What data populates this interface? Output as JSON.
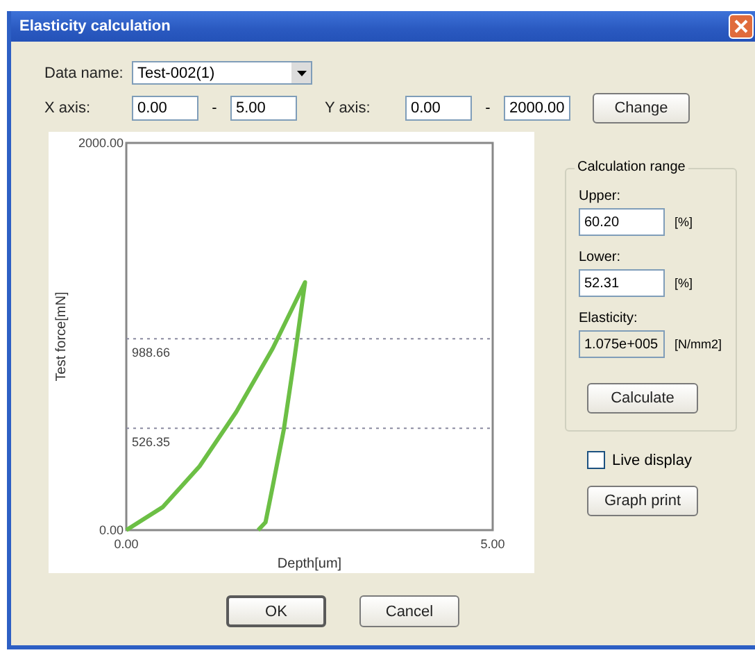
{
  "window": {
    "title": "Elasticity calculation"
  },
  "data_name": {
    "label": "Data name:",
    "value": "Test-002(1)"
  },
  "x_axis": {
    "label": "X axis:",
    "min": "0.00",
    "max": "5.00"
  },
  "y_axis": {
    "label": "Y axis:",
    "min": "0.00",
    "max": "2000.00"
  },
  "range_separator": "-",
  "change_button": "Change",
  "graph": {
    "chart_data": {
      "type": "line",
      "xlabel": "Depth[um]",
      "ylabel": "Test force[mN]",
      "xlim": [
        0,
        5
      ],
      "ylim": [
        0,
        2000
      ],
      "xticks": [
        {
          "value": 0,
          "label": "0.00"
        },
        {
          "value": 5,
          "label": "5.00"
        }
      ],
      "yticks": [
        {
          "value": 0,
          "label": "0.00"
        },
        {
          "value": 2000,
          "label": "2000.00"
        }
      ],
      "x": [
        0,
        0.5,
        1,
        1.5,
        2,
        2.44,
        2.3,
        2.15,
        2.0,
        1.9,
        1.8
      ],
      "series": [
        {
          "color": "#6cbf45",
          "values": [
            0,
            120,
            330,
            610,
            940,
            1280,
            900,
            520,
            230,
            40,
            0
          ]
        }
      ],
      "ref_lines": [
        {
          "axis": "y",
          "value": 988.66,
          "label": "988.66"
        },
        {
          "axis": "y",
          "value": 526.35,
          "label": "526.35"
        }
      ]
    }
  },
  "calc_range": {
    "title": "Calculation range",
    "upper_label": "Upper:",
    "upper_value": "60.20",
    "upper_unit": "[%]",
    "lower_label": "Lower:",
    "lower_value": "52.31",
    "lower_unit": "[%]",
    "modulus_label": "Elasticity:",
    "modulus_value": "1.075e+005",
    "modulus_unit": "[N/mm2]",
    "calculate_button": "Calculate"
  },
  "live_display": {
    "label": "Live display",
    "checked": false
  },
  "graph_print_button": "Graph print",
  "buttons": [
    "OK",
    "Cancel"
  ]
}
